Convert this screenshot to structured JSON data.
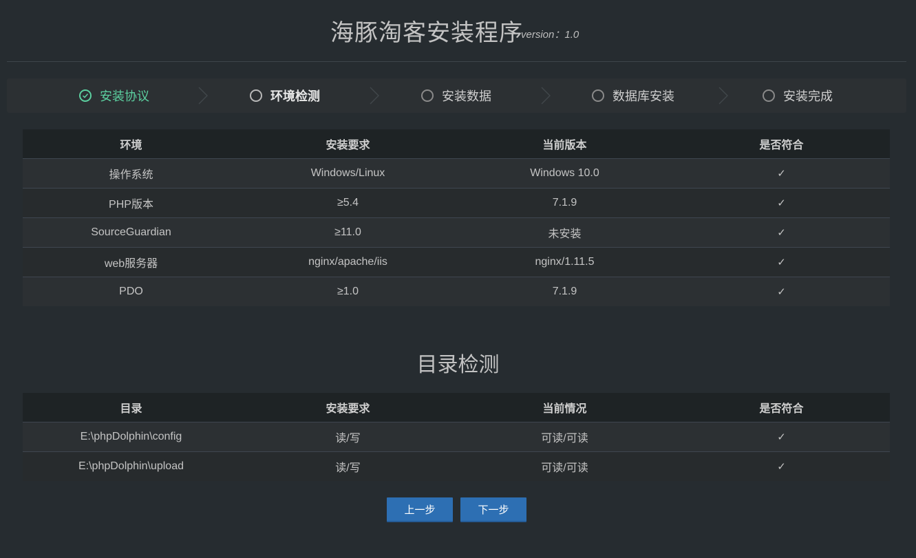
{
  "header": {
    "title": "海豚淘客安装程序",
    "version": "version：1.0"
  },
  "steps": [
    {
      "label": "安装协议",
      "state": "done"
    },
    {
      "label": "环境检测",
      "state": "active"
    },
    {
      "label": "安装数据",
      "state": "pending"
    },
    {
      "label": "数据库安装",
      "state": "pending"
    },
    {
      "label": "安装完成",
      "state": "pending"
    }
  ],
  "env_table": {
    "headers": [
      "环境",
      "安装要求",
      "当前版本",
      "是否符合"
    ],
    "rows": [
      {
        "name": "操作系统",
        "required": "Windows/Linux",
        "current": "Windows 10.0",
        "ok": "✓"
      },
      {
        "name": "PHP版本",
        "required": "≥5.4",
        "current": "7.1.9",
        "ok": "✓"
      },
      {
        "name": "SourceGuardian",
        "required": "≥11.0",
        "current": "未安装",
        "ok": "✓"
      },
      {
        "name": "web服务器",
        "required": "nginx/apache/iis",
        "current": "nginx/1.11.5",
        "ok": "✓"
      },
      {
        "name": "PDO",
        "required": "≥1.0",
        "current": "7.1.9",
        "ok": "✓"
      }
    ]
  },
  "dir_section": {
    "title": "目录检测"
  },
  "dir_table": {
    "headers": [
      "目录",
      "安装要求",
      "当前情况",
      "是否符合"
    ],
    "rows": [
      {
        "path": "E:\\phpDolphin\\config",
        "required": "读/写",
        "current": "可读/可读",
        "ok": "✓"
      },
      {
        "path": "E:\\phpDolphin\\upload",
        "required": "读/写",
        "current": "可读/可读",
        "ok": "✓"
      }
    ]
  },
  "buttons": {
    "prev": "上一步",
    "next": "下一步"
  },
  "colors": {
    "background": "#262c30",
    "step_done": "#5cd0a0",
    "button": "#2d6fb3"
  }
}
